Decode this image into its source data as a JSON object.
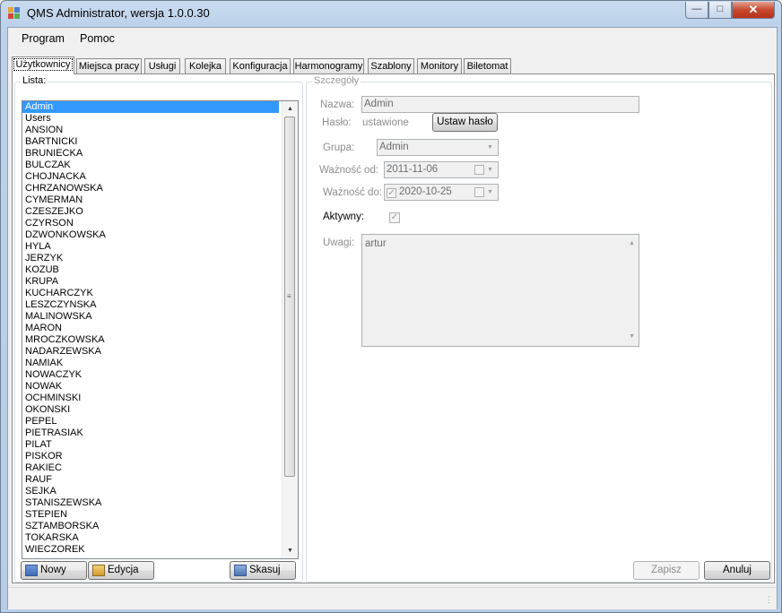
{
  "window": {
    "title": "QMS Administrator, wersja 1.0.0.30"
  },
  "menu": [
    "Program",
    "Pomoc"
  ],
  "tabs": [
    "Użytkownicy",
    "Miejsca pracy",
    "Usługi",
    "Kolejka",
    "Konfiguracja",
    "Harmonogramy",
    "Szablony",
    "Monitory",
    "Biletomat"
  ],
  "list": {
    "label": "Lista:",
    "selected": "Admin",
    "items": [
      "Admin",
      "Users",
      "ANSION",
      "BARTNICKI",
      "BRUNIECKA",
      "BULCZAK",
      "CHOJNACKA",
      "CHRZANOWSKA",
      "CYMERMAN",
      "CZESZEJKO",
      "CZYRSON",
      "DZWONKOWSKA",
      "HYLA",
      "JERZYK",
      "KOZUB",
      "KRUPA",
      "KUCHARCZYK",
      "LESZCZYNSKA",
      "MALINOWSKA",
      "MARON",
      "MROCZKOWSKA",
      "NADARZEWSKA",
      "NAMIAK",
      "NOWACZYK",
      "NOWAK",
      "OCHMINSKI",
      "OKONSKI",
      "PEPEL",
      "PIETRASIAK",
      "PILAT",
      "PISKOR",
      "RAKIEC",
      "RAUF",
      "SEJKA",
      "STANISZEWSKA",
      "STEPIEN",
      "SZTAMBORSKA",
      "TOKARSKA",
      "WIECZOREK"
    ],
    "buttons": {
      "new": "Nowy",
      "edit": "Edycja",
      "delete": "Skasuj"
    }
  },
  "details": {
    "label": "Szczegóły",
    "name_label": "Nazwa:",
    "name_value": "Admin",
    "password_label": "Hasło:",
    "password_value": "ustawione",
    "set_password_button": "Ustaw hasło",
    "group_label": "Grupa:",
    "group_value": "Admin",
    "valid_from_label": "Ważność od:",
    "valid_from_value": "2011-11-06",
    "valid_to_label": "Ważność do:",
    "valid_to_value": "2020-10-25",
    "valid_to_checked": true,
    "active_label": "Aktywny:",
    "active_checked": true,
    "notes_label": "Uwagi:",
    "notes_value": "artur",
    "save_button": "Zapisz",
    "cancel_button": "Anuluj"
  }
}
